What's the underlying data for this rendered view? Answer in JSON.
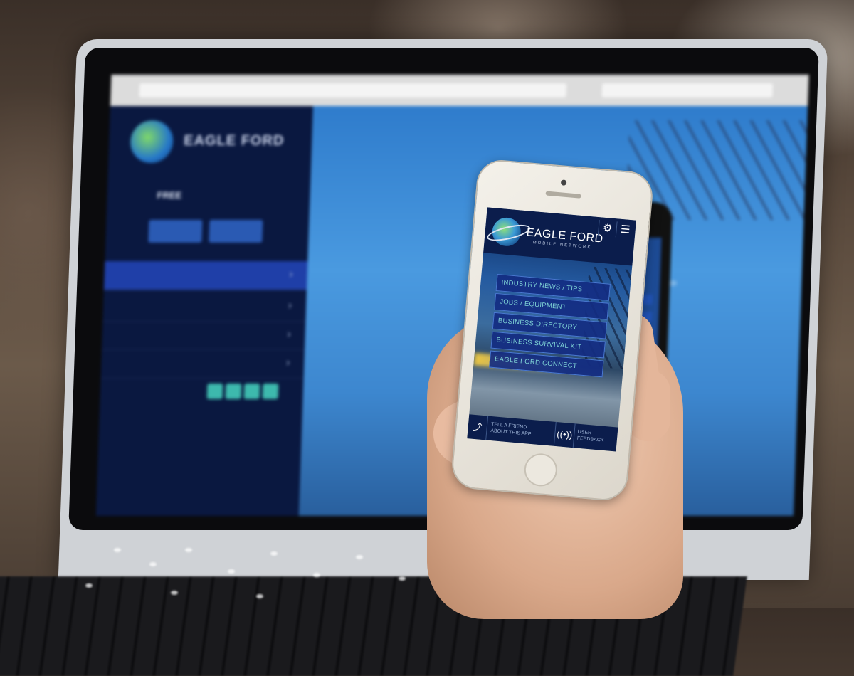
{
  "app": {
    "brand_title": "EAGLE FORD",
    "brand_subtitle": "MOBILE NETWORK",
    "menu_items": [
      {
        "label": "INDUSTRY NEWS / TIPS"
      },
      {
        "label": "JOBS / EQUIPMENT"
      },
      {
        "label": "BUSINESS DIRECTORY"
      },
      {
        "label": "BUSINESS SURVIVAL KIT"
      },
      {
        "label": "EAGLE FORD CONNECT"
      }
    ],
    "footer": {
      "share_label_line1": "TELL A FRIEND",
      "share_label_line2": "ABOUT THIS APP",
      "feedback_label_line1": "USER",
      "feedback_label_line2": "FEEDBACK"
    },
    "icons": {
      "settings": "gear-icon",
      "menu": "hamburger-icon",
      "share": "share-icon",
      "feedback": "broadcast-icon"
    }
  },
  "website": {
    "logo_text": "EAGLE FORD",
    "sidebar_price": "FREE"
  },
  "colors": {
    "app_header": "#0b1d4c",
    "menu_button": "#142d82",
    "menu_text": "#7fd3d6",
    "site_sidebar": "#0a1840",
    "site_nav_active": "#1f3fa8",
    "site_nav_text": "#29c36a"
  }
}
